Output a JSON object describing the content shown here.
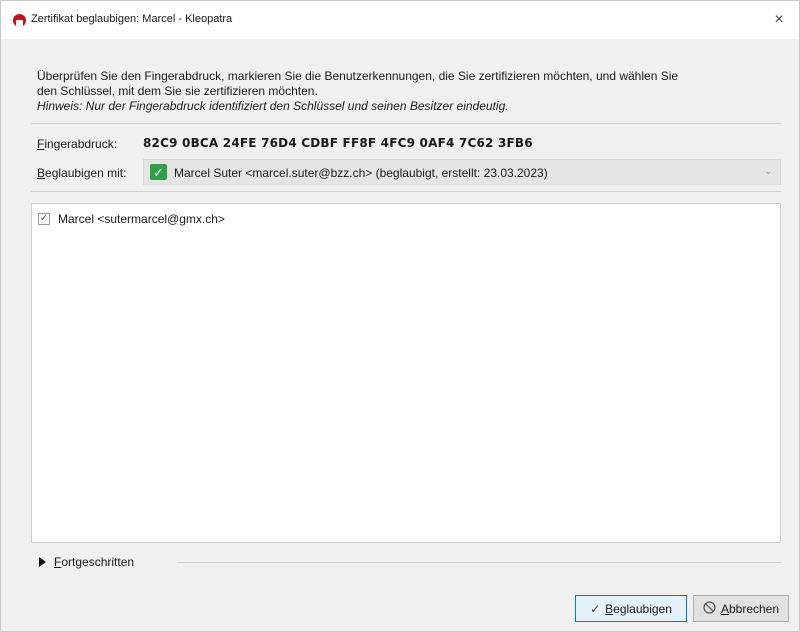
{
  "window": {
    "title": "Zertifikat beglaubigen: Marcel - Kleopatra",
    "close_glyph": "×"
  },
  "intro": {
    "line1": "Überprüfen Sie den Fingerabdruck, markieren Sie die Benutzerkennungen, die Sie zertifizieren möchten, und wählen Sie",
    "line2": "den Schlüssel, mit dem Sie sie zertifizieren möchten.",
    "hint": "Hinweis: Nur der Fingerabdruck identifiziert den Schlüssel und seinen Besitzer eindeutig."
  },
  "fingerprint": {
    "label_first": "F",
    "label_rest": "ingerabdruck:",
    "value": "82C9 0BCA 24FE 76D4 CDBF FF8F 4FC9 0AF4 7C62 3FB6"
  },
  "certify_with": {
    "label_first": "B",
    "label_rest": "eglaubigen mit:",
    "selected": "Marcel Suter <marcel.suter@bzz.ch> (beglaubigt, erstellt: 23.03.2023)",
    "check_glyph": "✓",
    "arrow_glyph": "⌄"
  },
  "user_ids": [
    {
      "checked": true,
      "label": "Marcel <sutermarcel@gmx.ch>"
    }
  ],
  "advanced": {
    "label_first": "F",
    "label_rest": "ortgeschritten"
  },
  "buttons": {
    "certify": {
      "icon": "✓",
      "label_first": "B",
      "label_rest": "eglaubigen"
    },
    "cancel": {
      "icon": "⃠",
      "label": "Abbrechen",
      "label_first": "A",
      "label_rest": "bbrechen"
    }
  },
  "colors": {
    "accent_border": "#0078d7",
    "check_green": "#2e9e47",
    "app_icon_red": "#c0161b"
  }
}
